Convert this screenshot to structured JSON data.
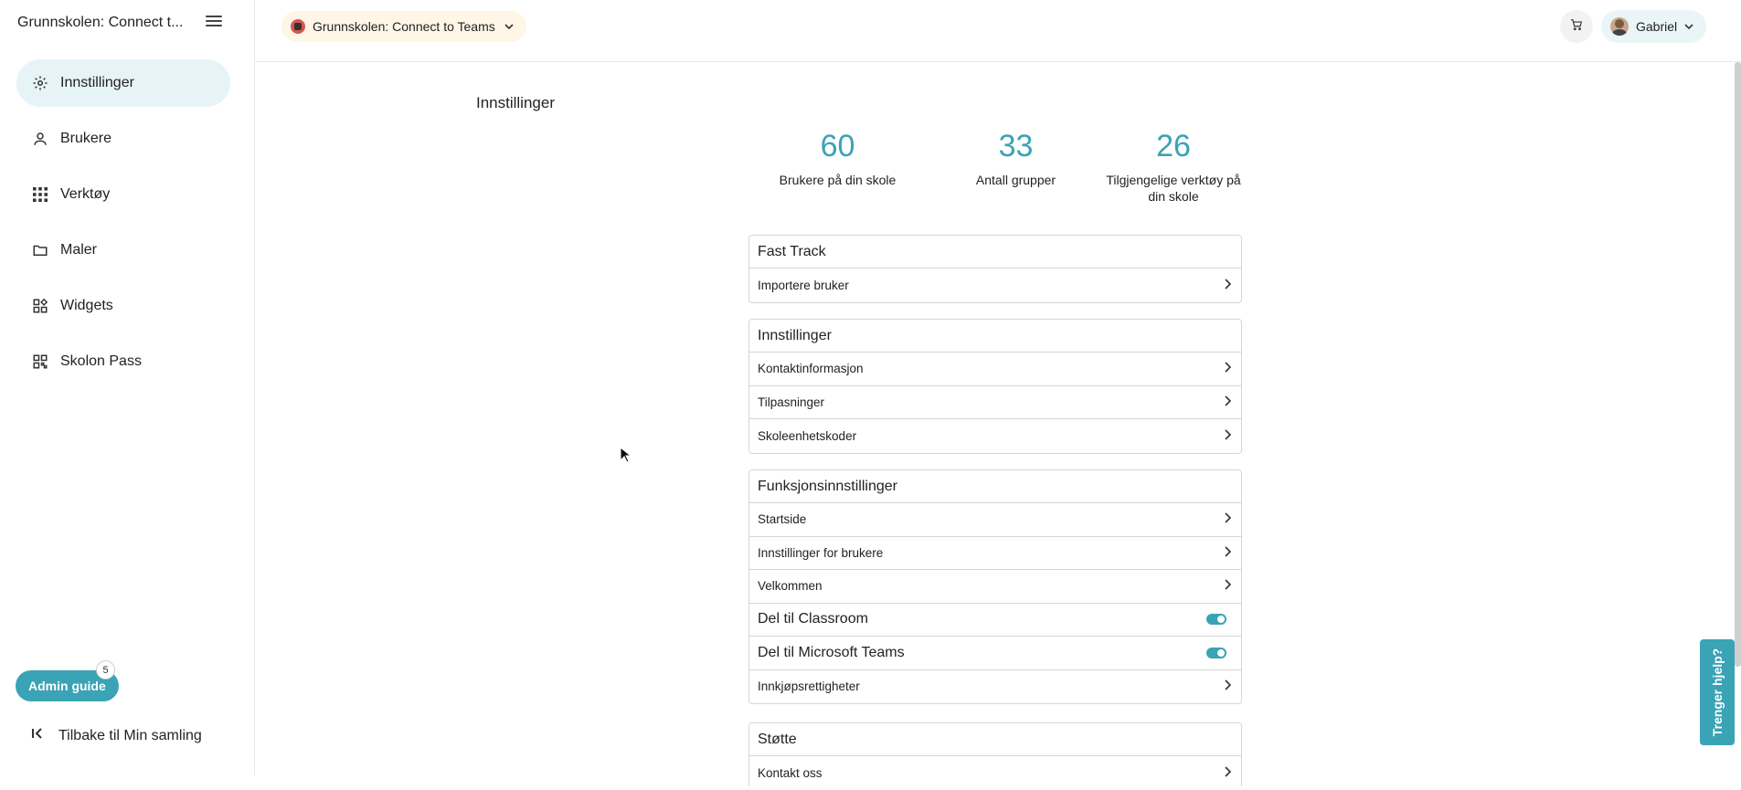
{
  "sidebar": {
    "title": "Grunnskolen: Connect t...",
    "items": [
      {
        "label": "Innstillinger",
        "icon": "gear-icon",
        "active": true
      },
      {
        "label": "Brukere",
        "icon": "person-icon"
      },
      {
        "label": "Verktøy",
        "icon": "apps-grid-icon"
      },
      {
        "label": "Maler",
        "icon": "folder-icon"
      },
      {
        "label": "Widgets",
        "icon": "widgets-icon"
      },
      {
        "label": "Skolon Pass",
        "icon": "qr-code-icon"
      }
    ],
    "admin_guide": "Admin guide",
    "admin_badge": "5",
    "back_label": "Tilbake til Min samling"
  },
  "topbar": {
    "school": "Grunnskolen: Connect to Teams",
    "user": "Gabriel"
  },
  "main": {
    "title": "Innstillinger",
    "stats": [
      {
        "value": "60",
        "label": "Brukere på din skole"
      },
      {
        "value": "33",
        "label": "Antall grupper"
      },
      {
        "value": "26",
        "label": "Tilgjengelige verktøy på din skole"
      }
    ],
    "sections": [
      {
        "title": "Fast Track",
        "rows": [
          "Importere bruker"
        ]
      },
      {
        "title": "Innstillinger",
        "rows": [
          "Kontaktinformasjon",
          "Tilpasninger",
          "Skoleenhetskoder"
        ]
      },
      {
        "title": "Funksjonsinnstillinger",
        "rows": [
          "Startside",
          "Innstillinger for brukere",
          "Velkommen",
          "Del til Classroom",
          "Del til Microsoft Teams",
          "Innkjøpsrettigheter"
        ]
      },
      {
        "title": "Støtte",
        "rows": [
          "Kontakt oss"
        ]
      }
    ]
  },
  "help_tab": "Trenger hjelp?",
  "colors": {
    "accent": "#3aa3b5",
    "active_bg": "#e6f4f7",
    "school_pill_bg": "#fff6e8"
  }
}
